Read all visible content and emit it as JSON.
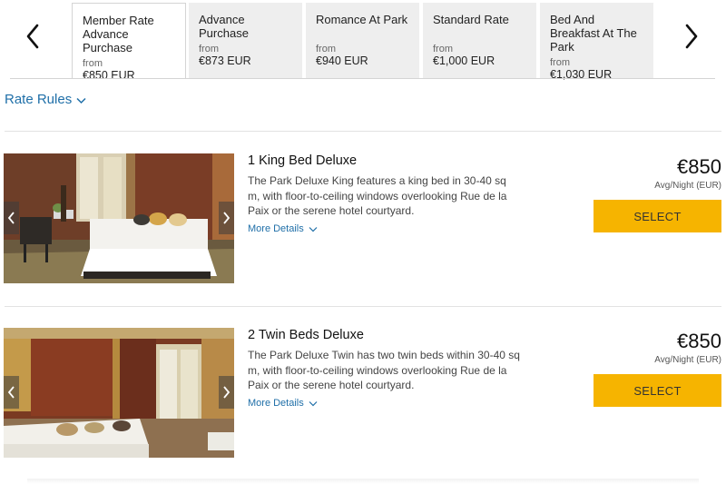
{
  "tabs": [
    {
      "name": "Member Rate Advance Purchase",
      "from": "from",
      "price": "€850 EUR",
      "active": true
    },
    {
      "name": "Advance Purchase",
      "from": "from",
      "price": "€873 EUR",
      "active": false
    },
    {
      "name": "Romance At Park",
      "from": "from",
      "price": "€940 EUR",
      "active": false
    },
    {
      "name": "Standard Rate",
      "from": "from",
      "price": "€1,000 EUR",
      "active": false
    },
    {
      "name": "Bed And Breakfast At The Park",
      "from": "from",
      "price": "€1,030 EUR",
      "active": false
    }
  ],
  "nav": {
    "prev_icon": "chevron-left-icon",
    "next_icon": "chevron-right-icon"
  },
  "rate_rules": {
    "label": "Rate Rules"
  },
  "rooms": [
    {
      "title": "1 King Bed Deluxe",
      "description": "The Park Deluxe King features a king bed in 30-40 sq m, with floor-to-ceiling windows overlooking Rue de la Paix or the serene hotel courtyard.",
      "more_details": "More Details",
      "price": "€850",
      "price_note": "Avg/Night (EUR)",
      "select_label": "SELECT"
    },
    {
      "title": "2 Twin Beds Deluxe",
      "description": "The Park Deluxe Twin has two twin beds within 30-40 sq m, with floor-to-ceiling windows overlooking Rue de la Paix or the serene hotel courtyard.",
      "more_details": "More Details",
      "price": "€850",
      "price_note": "Avg/Night (EUR)",
      "select_label": "SELECT"
    }
  ],
  "colors": {
    "accent": "#1f6fa8",
    "select_button": "#f6b400",
    "tab_inactive": "#eeeeee"
  }
}
